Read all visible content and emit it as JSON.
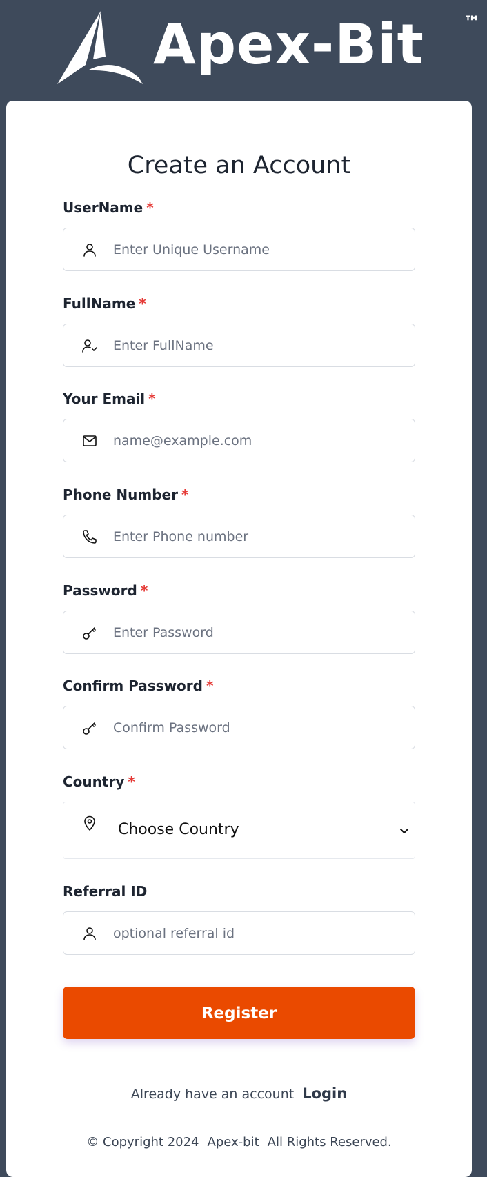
{
  "brand": {
    "name": "Apex-Bit",
    "trademark": "™"
  },
  "form": {
    "title": "Create an Account",
    "required_marker": "*",
    "fields": [
      {
        "label": "UserName",
        "placeholder": "Enter Unique Username",
        "icon": "user-icon"
      },
      {
        "label": "FullName",
        "placeholder": "Enter FullName",
        "icon": "user-check-icon"
      },
      {
        "label": "Your Email",
        "placeholder": "name@example.com",
        "icon": "mail-icon"
      },
      {
        "label": "Phone Number",
        "placeholder": "Enter Phone number",
        "icon": "phone-icon"
      },
      {
        "label": "Password",
        "placeholder": "Enter Password",
        "icon": "key-icon"
      },
      {
        "label": "Confirm Password",
        "placeholder": "Confirm Password",
        "icon": "key-icon"
      }
    ],
    "country": {
      "label": "Country",
      "selected": "Choose Country",
      "icon": "map-pin-icon"
    },
    "referral": {
      "label": "Referral ID",
      "placeholder": "optional referral id",
      "icon": "user-icon"
    },
    "submit_label": "Register"
  },
  "login_prompt": {
    "text": "Already have an account",
    "link": "Login"
  },
  "footer": {
    "copyright": "© Copyright 2024",
    "company": "Apex-bit",
    "rights": "All Rights Reserved."
  },
  "colors": {
    "background": "#3e4a5b",
    "accent": "#ea4a00",
    "required": "#e53935"
  }
}
